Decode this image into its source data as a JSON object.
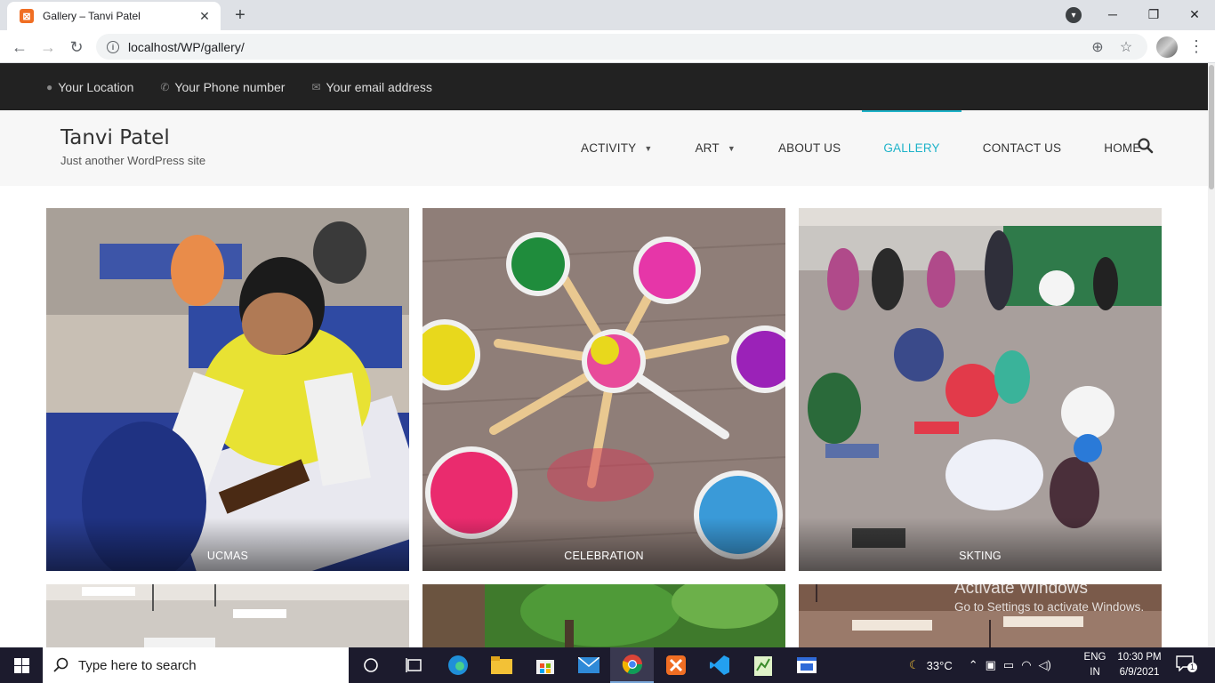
{
  "browser": {
    "tab_title": "Gallery – Tanvi Patel",
    "url": "localhost/WP/gallery/"
  },
  "topbar": {
    "location": "Your Location",
    "phone": "Your Phone number",
    "email": "Your email address"
  },
  "site": {
    "title": "Tanvi Patel",
    "description": "Just another WordPress site"
  },
  "menu": {
    "items": [
      {
        "label": "ACTIVITY"
      },
      {
        "label": "ART"
      },
      {
        "label": "ABOUT US"
      },
      {
        "label": "GALLERY"
      },
      {
        "label": "CONTACT US"
      },
      {
        "label": "HOME"
      }
    ]
  },
  "gallery": {
    "items": [
      {
        "caption": "UCMAS"
      },
      {
        "caption": "CELEBRATION"
      },
      {
        "caption": "SKTING"
      }
    ]
  },
  "watermark": {
    "title": "Activate Windows",
    "subtitle": "Go to Settings to activate Windows."
  },
  "taskbar": {
    "search_placeholder": "Type here to search",
    "temperature": "33°C",
    "lang_line1": "ENG",
    "lang_line2": "IN",
    "time": "10:30 PM",
    "date": "6/9/2021",
    "notification_count": "1"
  },
  "colors": {
    "accent": "#1fb3c9",
    "topbar_bg": "#222222",
    "header_bg": "#f7f7f7"
  }
}
